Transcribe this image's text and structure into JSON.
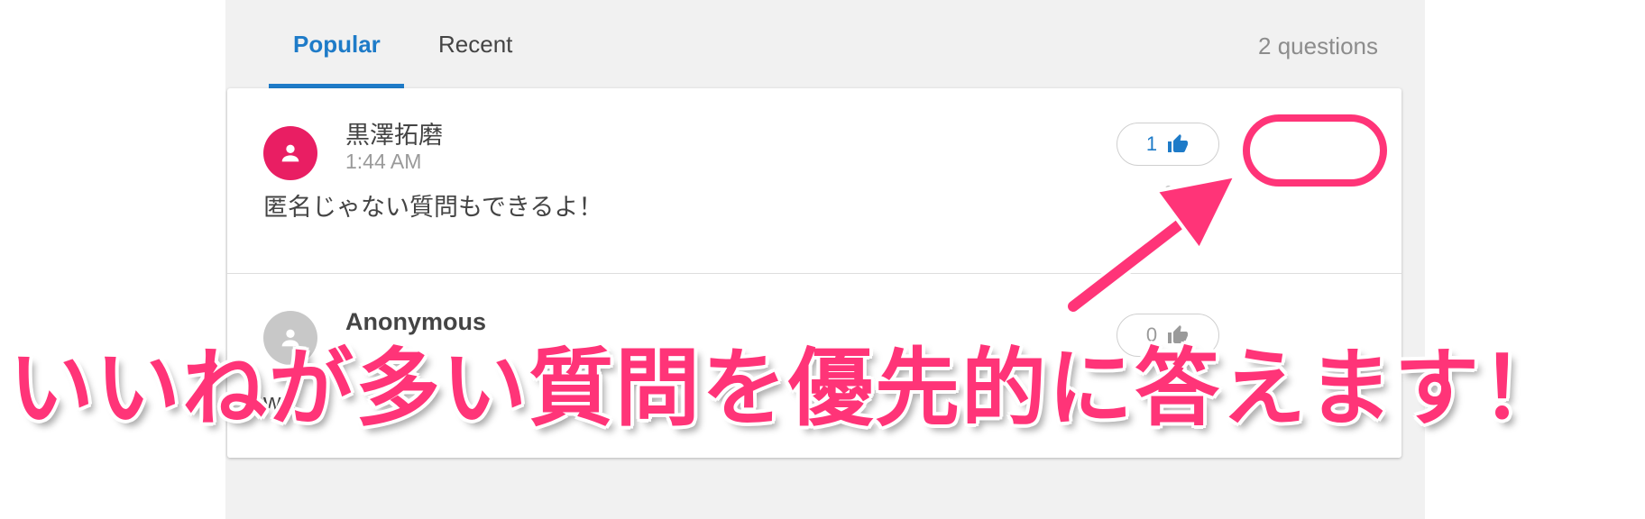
{
  "tabs": [
    {
      "label": "Popular",
      "active": true
    },
    {
      "label": "Recent",
      "active": false
    }
  ],
  "question_count": "2 questions",
  "questions": [
    {
      "author": "黒澤拓磨",
      "time": "1:44 AM",
      "text": "匿名じゃない質問もできるよ！",
      "likes": "1",
      "avatar_color": "#e91e63",
      "more_icon": "more-horizontal-icon"
    },
    {
      "author": "Anonymous",
      "time": "",
      "text": "wo",
      "likes": "0",
      "avatar_color": "#c8c8c8"
    }
  ],
  "annotation": {
    "text": "いいねが多い質問を優先的に答えます！",
    "color": "#ff3478"
  },
  "colors": {
    "accent": "#1e7bc8",
    "highlight": "#ff3478",
    "panel_bg": "#f1f1f1"
  }
}
